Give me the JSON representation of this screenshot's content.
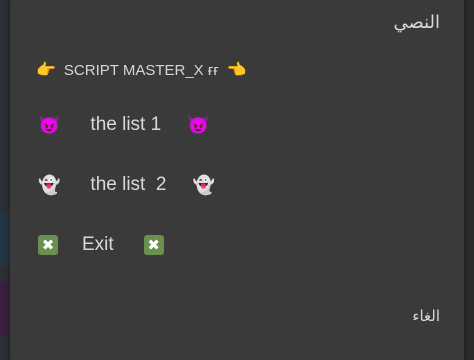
{
  "dialog": {
    "title": "النصي",
    "header": {
      "left_icon": "👉",
      "text": "SCRIPT MASTER_X ғғ",
      "right_icon": "👈"
    },
    "items": [
      {
        "icon": "😈",
        "label": "the list 1",
        "trailing_icon": "😈"
      },
      {
        "icon": "👻",
        "label": "the list  2",
        "trailing_icon": "👻"
      },
      {
        "icon": "✖",
        "label": "Exit",
        "trailing_icon": "✖"
      }
    ],
    "cancel_label": "الغاء"
  },
  "colors": {
    "dialog_bg": "#3a3a3a",
    "text": "#d9d9d9",
    "exit_icon_bg": "#6a8f4e"
  }
}
